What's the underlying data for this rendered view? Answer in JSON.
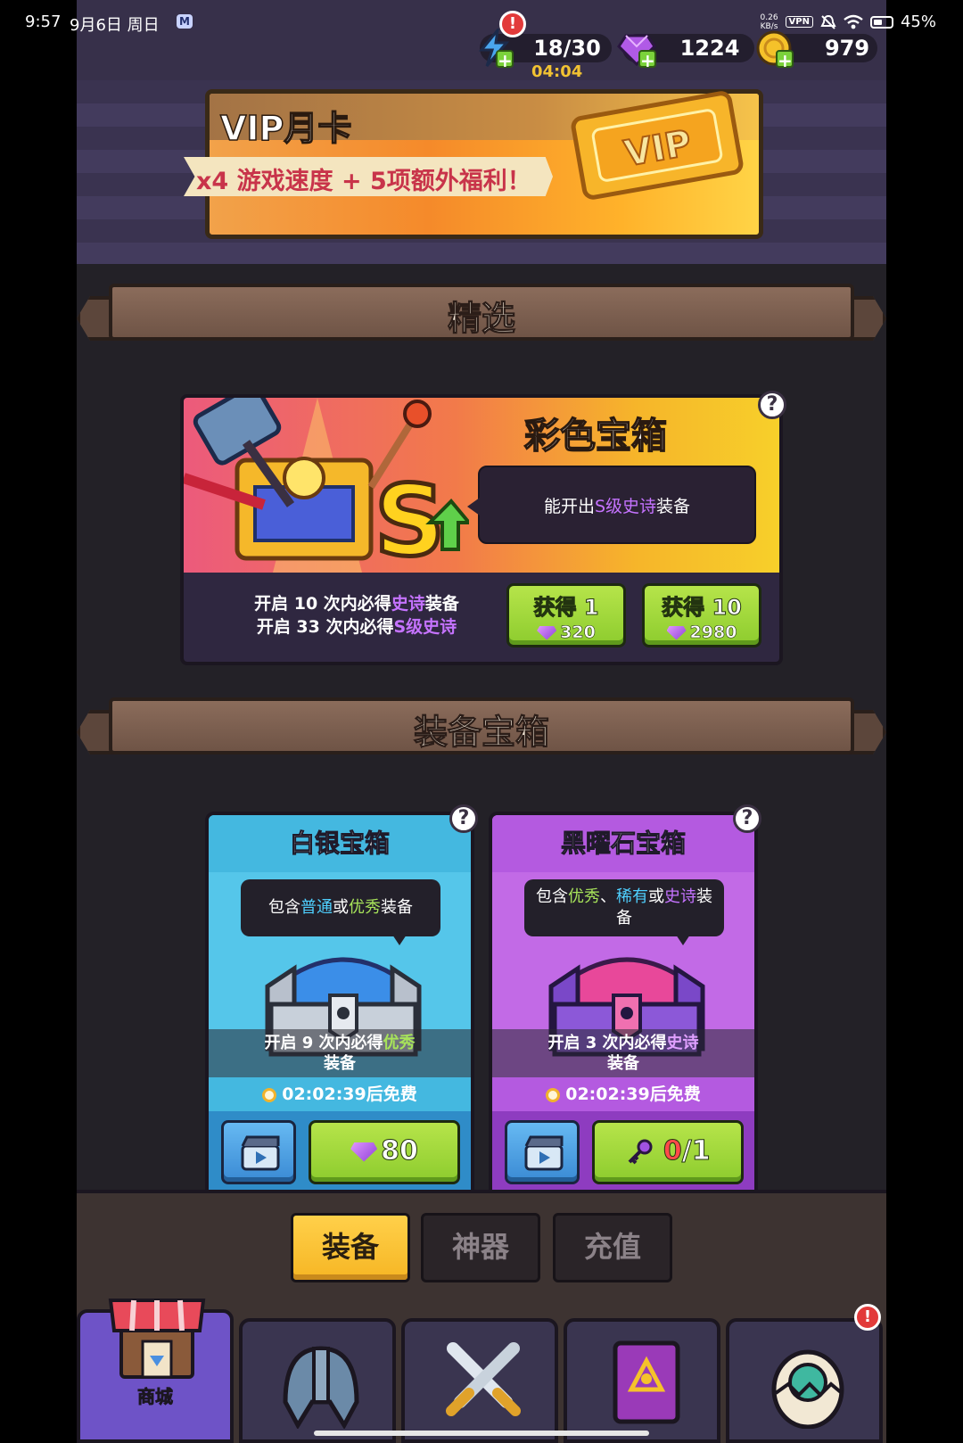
{
  "status_bar": {
    "time": "9:57",
    "date": "9月6日 周日",
    "net_speed_value": "0.26",
    "net_speed_unit": "KB/s",
    "vpn": "VPN",
    "battery": "45%"
  },
  "resources": {
    "energy": "18/30",
    "energy_timer": "04:04",
    "gems": "1224",
    "gold": "979",
    "alert": "!"
  },
  "vip": {
    "title": "VIP月卡",
    "benefit": "x4 游戏速度 + 5项额外福利！",
    "ticket_text": "VIP"
  },
  "featured": {
    "section_title": "精选",
    "chest_title": "彩色宝箱",
    "bubble_prefix": "能开出",
    "bubble_highlight": "S级史诗",
    "bubble_suffix": "装备",
    "line1_prefix": "开启 10 次内必得",
    "line1_highlight": "史诗",
    "line1_suffix": "装备",
    "line2_prefix": "开启 33 次内必得",
    "line2_highlight": "S级史诗",
    "buy1_label": "获得 1",
    "buy1_cost": "320",
    "buy10_label": "获得 10",
    "buy10_cost": "2980",
    "help": "?"
  },
  "equipment": {
    "section_title": "装备宝箱",
    "silver": {
      "title": "白银宝箱",
      "tip_a": "包含",
      "tip_b": "普通",
      "tip_c": "或",
      "tip_d": "优秀",
      "tip_e": "装备",
      "guarantee_prefix": "开启 9 次内必得",
      "guarantee_highlight": "优秀",
      "guarantee_suffix": "装备",
      "free_timer": "02:02:39后免费",
      "price": "80",
      "help": "?"
    },
    "obsidian": {
      "title": "黑曜石宝箱",
      "tip_a": "包含",
      "tip_b": "优秀",
      "tip_c": "、",
      "tip_d": "稀有",
      "tip_e": "或",
      "tip_f": "史诗",
      "tip_g": "装备",
      "guarantee_prefix": "开启 3 次内必得",
      "guarantee_highlight": "史诗",
      "guarantee_suffix": "装备",
      "free_timer": "02:02:39后免费",
      "keys_have": "0",
      "keys_total": "/1",
      "help": "?"
    }
  },
  "shop_tabs": [
    {
      "label": "装备"
    },
    {
      "label": "神器"
    },
    {
      "label": "充值"
    }
  ],
  "nav": {
    "shop_label": "商城",
    "alert": "!"
  },
  "colors": {
    "highlight_purple": "#c573ff",
    "highlight_green": "#a7e35a",
    "highlight_blue": "#4fd0ff",
    "keys_red": "#ff4a4a",
    "active_tab": "#f6b624",
    "button_green": "#8dcc2e"
  }
}
